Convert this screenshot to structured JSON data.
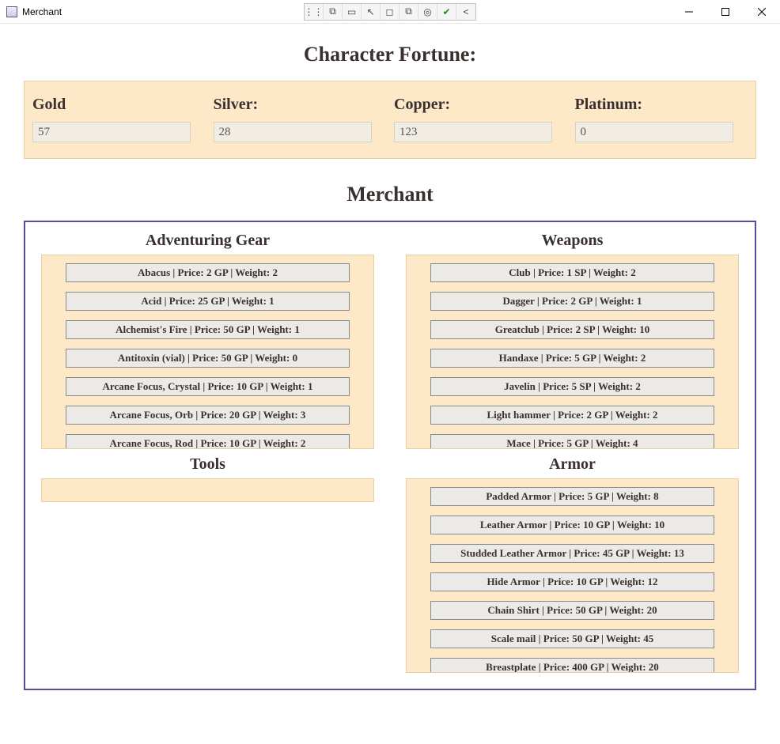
{
  "window": {
    "title": "Merchant"
  },
  "headings": {
    "fortune": "Character Fortune:",
    "merchant": "Merchant"
  },
  "fortune": {
    "gold_label": "Gold",
    "gold_value": "57",
    "silver_label": "Silver:",
    "silver_value": "28",
    "copper_label": "Copper:",
    "copper_value": "123",
    "platinum_label": "Platinum:",
    "platinum_value": "0"
  },
  "categories": {
    "adventuring_gear": {
      "title": "Adventuring Gear",
      "items": [
        "Abacus | Price: 2 GP | Weight: 2",
        "Acid | Price: 25 GP | Weight: 1",
        "Alchemist's Fire | Price: 50 GP | Weight: 1",
        "Antitoxin (vial) | Price: 50 GP | Weight: 0",
        "Arcane Focus, Crystal | Price: 10 GP | Weight: 1",
        "Arcane Focus, Orb | Price: 20 GP | Weight: 3",
        "Arcane Focus, Rod | Price: 10 GP | Weight: 2"
      ]
    },
    "weapons": {
      "title": "Weapons",
      "items": [
        "Club | Price: 1 SP | Weight: 2",
        "Dagger | Price: 2 GP | Weight: 1",
        "Greatclub | Price: 2 SP | Weight: 10",
        "Handaxe | Price: 5 GP | Weight: 2",
        "Javelin | Price: 5 SP | Weight: 2",
        "Light hammer | Price: 2 GP | Weight: 2",
        "Mace | Price: 5 GP | Weight: 4"
      ]
    },
    "tools": {
      "title": "Tools",
      "items": []
    },
    "armor": {
      "title": "Armor",
      "items": [
        "Padded Armor | Price: 5 GP | Weight: 8",
        "Leather Armor | Price: 10 GP | Weight: 10",
        "Studded Leather Armor | Price: 45 GP | Weight: 13",
        "Hide Armor | Price: 10 GP | Weight: 12",
        "Chain Shirt | Price: 50 GP | Weight: 20",
        "Scale mail | Price: 50 GP | Weight: 45",
        "Breastplate | Price: 400 GP | Weight: 20"
      ]
    }
  }
}
